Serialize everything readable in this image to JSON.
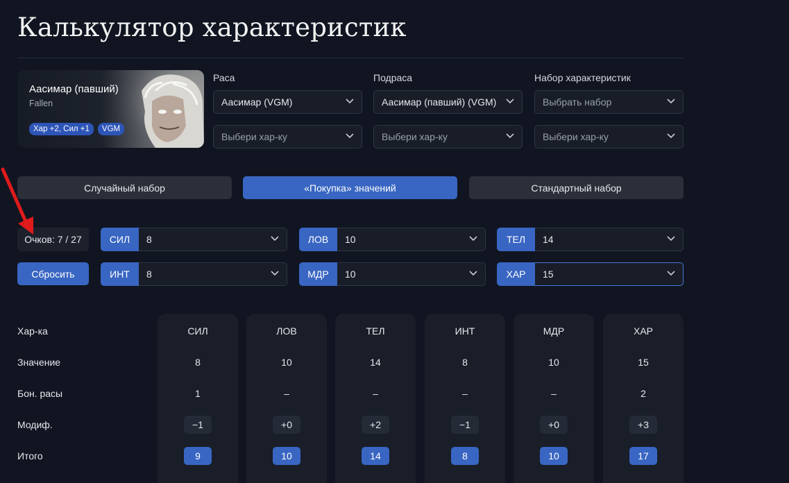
{
  "page": {
    "title": "Калькулятор характеристик"
  },
  "race_card": {
    "name": "Аасимар (павший)",
    "subtitle": "Fallen",
    "tags": [
      "Хар +2, Сил +1",
      "VGM"
    ]
  },
  "fields": {
    "race": {
      "label": "Раса",
      "value": "Аасимар (VGM)",
      "sub_placeholder": "Выбери хар-ку"
    },
    "subrace": {
      "label": "Подраса",
      "value": "Аасимар (павший) (VGM)",
      "sub_placeholder": "Выбери хар-ку"
    },
    "stat_set": {
      "label": "Набор характеристик",
      "placeholder": "Выбрать набор",
      "sub_placeholder": "Выбери хар-ку"
    }
  },
  "modes": [
    {
      "label": "Случайный набор",
      "active": false
    },
    {
      "label": "«Покупка» значений",
      "active": true
    },
    {
      "label": "Стандартный набор",
      "active": false
    }
  ],
  "points": {
    "label": "Очков: 7 / 27"
  },
  "reset": {
    "label": "Сбросить"
  },
  "stat_inputs": [
    {
      "abbr": "СИЛ",
      "value": "8"
    },
    {
      "abbr": "ЛОВ",
      "value": "10"
    },
    {
      "abbr": "ТЕЛ",
      "value": "14"
    },
    {
      "abbr": "ИНТ",
      "value": "8"
    },
    {
      "abbr": "МДР",
      "value": "10"
    },
    {
      "abbr": "ХАР",
      "value": "15"
    }
  ],
  "table": {
    "row_labels": [
      "Хар-ка",
      "Значение",
      "Бон. расы",
      "Модиф.",
      "Итого"
    ],
    "columns": [
      {
        "name": "СИЛ",
        "value": "8",
        "race_bonus": "1",
        "modifier": "−1",
        "total": "9"
      },
      {
        "name": "ЛОВ",
        "value": "10",
        "race_bonus": "–",
        "modifier": "+0",
        "total": "10"
      },
      {
        "name": "ТЕЛ",
        "value": "14",
        "race_bonus": "–",
        "modifier": "+2",
        "total": "14"
      },
      {
        "name": "ИНТ",
        "value": "8",
        "race_bonus": "–",
        "modifier": "−1",
        "total": "8"
      },
      {
        "name": "МДР",
        "value": "10",
        "race_bonus": "–",
        "modifier": "+0",
        "total": "10"
      },
      {
        "name": "ХАР",
        "value": "15",
        "race_bonus": "2",
        "modifier": "+3",
        "total": "17"
      }
    ]
  },
  "colors": {
    "accent": "#3966c2",
    "background": "#101521",
    "annotation_arrow": "#e01b1b"
  }
}
